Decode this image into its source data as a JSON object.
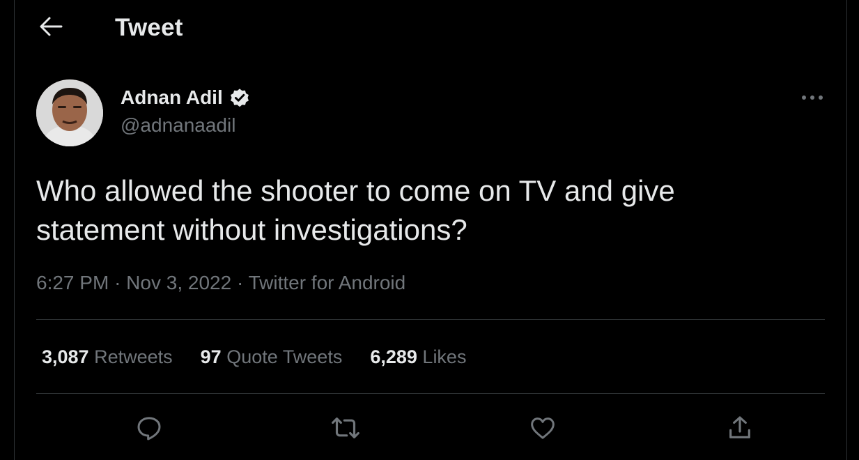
{
  "header": {
    "title": "Tweet"
  },
  "author": {
    "name": "Adnan Adil",
    "handle": "@adnanaadil",
    "verified": true
  },
  "tweet": {
    "text_line1": "Who allowed the shooter to come on TV and give",
    "text_line2": "statement without investigations?",
    "time": "6:27 PM",
    "date": "Nov 3, 2022",
    "source": "Twitter for Android",
    "separator": "·"
  },
  "stats": {
    "retweets_count": "3,087",
    "retweets_label": "Retweets",
    "quotes_count": "97",
    "quotes_label": "Quote Tweets",
    "likes_count": "6,289",
    "likes_label": "Likes"
  },
  "icons": {
    "back": "arrow-left-icon",
    "verified": "verified-badge-icon",
    "more": "more-horizontal-icon",
    "reply": "reply-icon",
    "retweet": "retweet-icon",
    "like": "heart-icon",
    "share": "share-icon"
  },
  "colors": {
    "background": "#000000",
    "text": "#e7e9ea",
    "muted": "#71767b",
    "border": "#2f3336"
  }
}
